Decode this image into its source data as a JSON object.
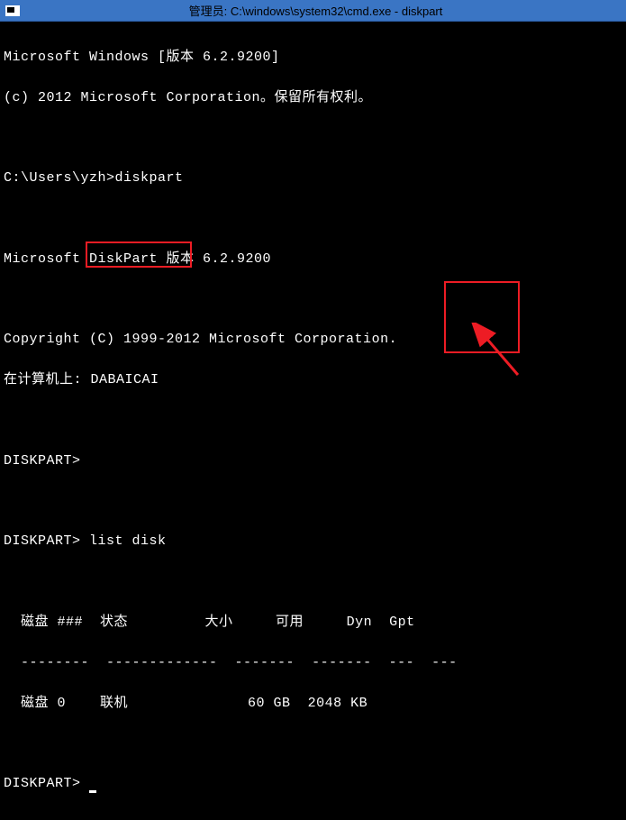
{
  "titlebar": {
    "title": "管理员: C:\\windows\\system32\\cmd.exe - diskpart"
  },
  "terminal": {
    "line1": "Microsoft Windows [版本 6.2.9200]",
    "line2": "(c) 2012 Microsoft Corporation。保留所有权利。",
    "line3": "",
    "prompt1_path": "C:\\Users\\yzh>",
    "prompt1_cmd": "diskpart",
    "line5": "",
    "line6": "Microsoft DiskPart 版本 6.2.9200",
    "line7": "",
    "line8": "Copyright (C) 1999-2012 Microsoft Corporation.",
    "line9_prefix": "在计算机上: ",
    "line9_computer": "DABAICAI",
    "line10": "",
    "prompt2": "DISKPART>",
    "line12": "",
    "prompt3": "DISKPART> ",
    "prompt3_cmd": "list disk",
    "line14": "",
    "header_disk": "  磁盘 ###",
    "header_status": "  状态",
    "header_size": "         大小",
    "header_free": "     可用",
    "header_dyn": "     Dyn",
    "header_gpt": "  Gpt",
    "sep_disk": "  --------",
    "sep_status": "  -------------",
    "sep_size": "  -------",
    "sep_free": "  -------",
    "sep_dyn": "  ---",
    "sep_gpt": "  ---",
    "row_disk": "  磁盘 0",
    "row_status": "    联机",
    "row_size": "              60 GB",
    "row_free": "  2048 KB",
    "row_dyn": "        ",
    "row_gpt": "",
    "line18": "",
    "prompt4": "DISKPART> "
  }
}
